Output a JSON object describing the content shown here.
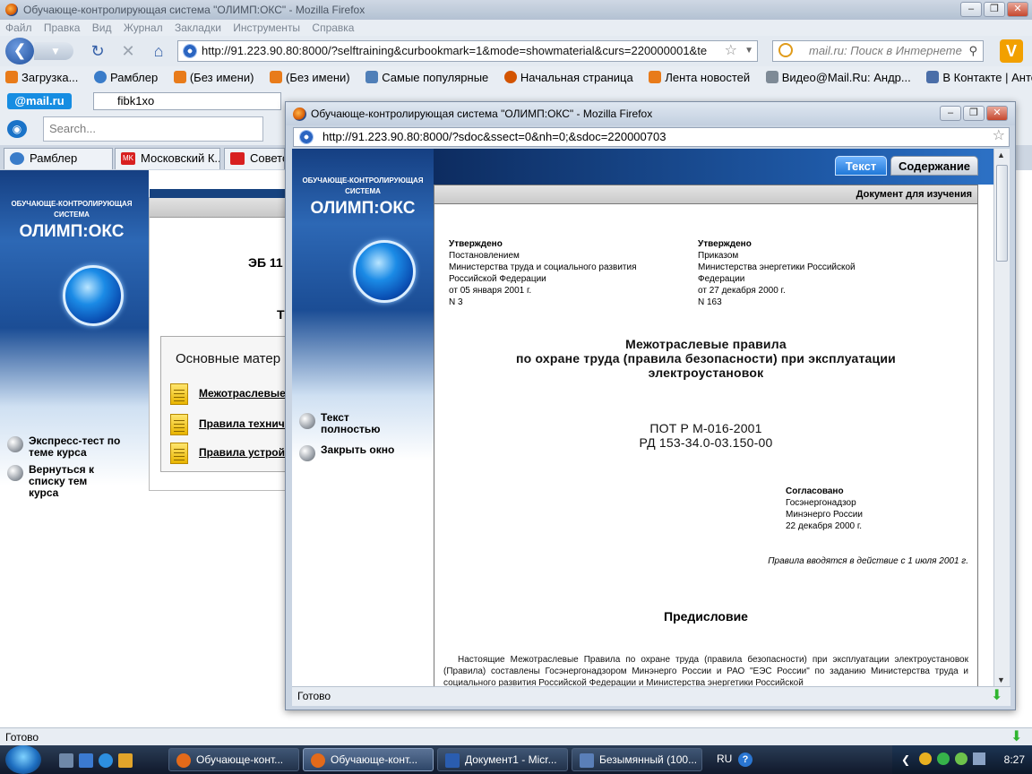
{
  "main_window": {
    "title": "Обучающе-контролирующая система \"ОЛИМП:ОКС\" - Mozilla Firefox",
    "menu": [
      "Файл",
      "Правка",
      "Вид",
      "Журнал",
      "Закладки",
      "Инструменты",
      "Справка"
    ],
    "url": "http://91.223.90.80:8000/?selftraining&curbookmark=1&mode=showmaterial&curs=220000001&te",
    "search_placeholder": "mail.ru: Поиск в Интернете",
    "bookmarks": [
      "Загрузка...",
      "Рамблер",
      "(Без имени)",
      "(Без имени)",
      "Самые популярные",
      "Начальная страница",
      "Лента новостей",
      "Видео@Mail.Ru: Андр...",
      "В Контакте | Антон Ру..."
    ],
    "mailru_logo": "@mail.ru",
    "mail_input_value": "fibk1xo",
    "search2_placeholder": "Search...",
    "tabs": [
      "Рамблер",
      "Московский К...",
      "Советс"
    ],
    "status": "Готово"
  },
  "main_page": {
    "logo_top": "ОБУЧАЮЩЕ-КОНТРОЛИРУЮЩАЯ СИСТЕМА",
    "logo_main": "ОЛИМП:ОКС",
    "side_links": [
      "Экспресс-тест по теме курса",
      "Вернуться к списку тем курса"
    ],
    "eb_text": "ЭБ 11",
    "t_text": "Т",
    "materials_title": "Основные матер",
    "materials": [
      "Межотраслевые",
      "Правила техничн",
      "Правила устрой"
    ]
  },
  "popup": {
    "title": "Обучающе-контролирующая система \"ОЛИМП:ОКС\" - Mozilla Firefox",
    "url": "http://91.223.90.80:8000/?sdoc&ssect=0&nh=0;&sdoc=220000703",
    "tab_text": "Текст",
    "tab_contents": "Содержание",
    "doc_header": "Документ для изучения",
    "side_links": [
      "Текст полностью",
      "Закрыть окно"
    ],
    "approved_left": {
      "label": "Утверждено",
      "lines": [
        "Постановлением",
        "Министерства труда и социального развития",
        "Российской Федерации",
        "от 05 января 2001 г.",
        "N 3"
      ]
    },
    "approved_right": {
      "label": "Утверждено",
      "lines": [
        "Приказом",
        "Министерства энергетики Российской",
        "Федерации",
        "от 27 декабря 2000 г.",
        "N 163"
      ]
    },
    "doc_title": [
      "Межотраслевые правила",
      "по охране труда (правила безопасности) при эксплуатации",
      "электроустановок"
    ],
    "doc_codes": [
      "ПОТ Р М-016-2001",
      "РД 153-34.0-03.150-00"
    ],
    "agreed": {
      "label": "Согласовано",
      "lines": [
        "Госэнергонадзор",
        "Минэнерго России",
        "22 декабря 2000 г."
      ]
    },
    "effective_note": "Правила вводятся в действие с 1 июля 2001 г.",
    "preface": "Предисловие",
    "paragraph": "Настоящие Межотраслевые Правила по охране труда (правила безопасности) при эксплуатации электроустановок (Правила) составлены Госэнергонадзором Минэнерго России и РАО \"ЕЭС России\" по заданию Министерства труда и социального развития Российской Федерации и Министерства энергетики Российской",
    "status": "Готово"
  },
  "taskbar": {
    "buttons": [
      "Обучающе-конт...",
      "Обучающе-конт...",
      "Документ1 - Micr...",
      "Безымянный (100..."
    ],
    "lang": "RU",
    "clock": "8:27"
  }
}
